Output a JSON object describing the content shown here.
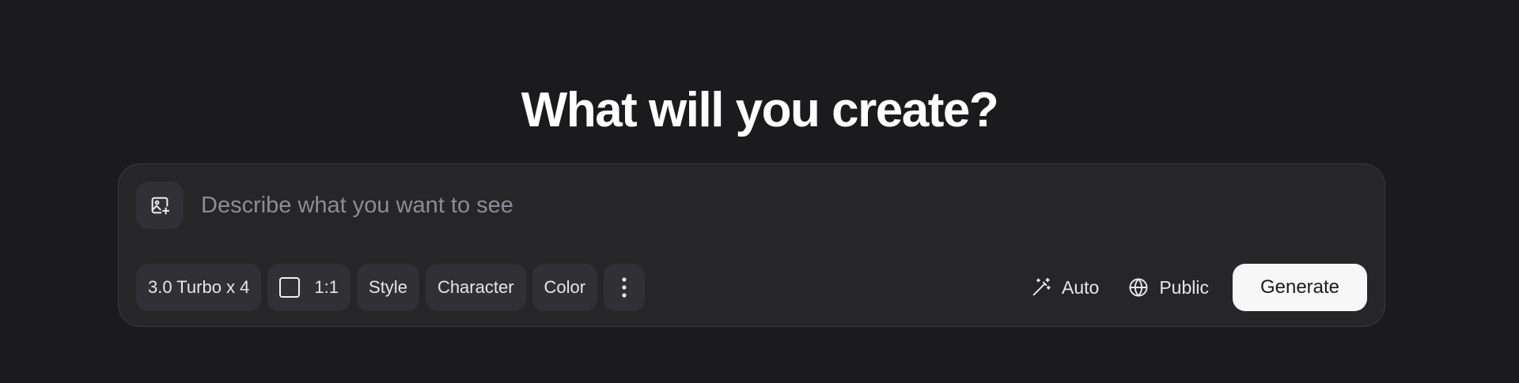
{
  "heading": "What will you create?",
  "prompt": {
    "placeholder": "Describe what you want to see",
    "value": ""
  },
  "image_upload": {
    "icon": "image-plus-icon"
  },
  "options": {
    "model_label": "3.0 Turbo x 4",
    "aspect_ratio_label": "1:1",
    "aspect_ratio_icon": "square-icon",
    "style_label": "Style",
    "character_label": "Character",
    "color_label": "Color",
    "more_icon": "vertical-dots-icon"
  },
  "right_controls": {
    "auto_label": "Auto",
    "auto_icon": "magic-wand-icon",
    "visibility_label": "Public",
    "visibility_icon": "globe-icon",
    "generate_label": "Generate"
  },
  "colors": {
    "background": "#1b1b1d",
    "panel": "#262629",
    "chip": "#313135",
    "generate_button": "#f7f7f8"
  }
}
